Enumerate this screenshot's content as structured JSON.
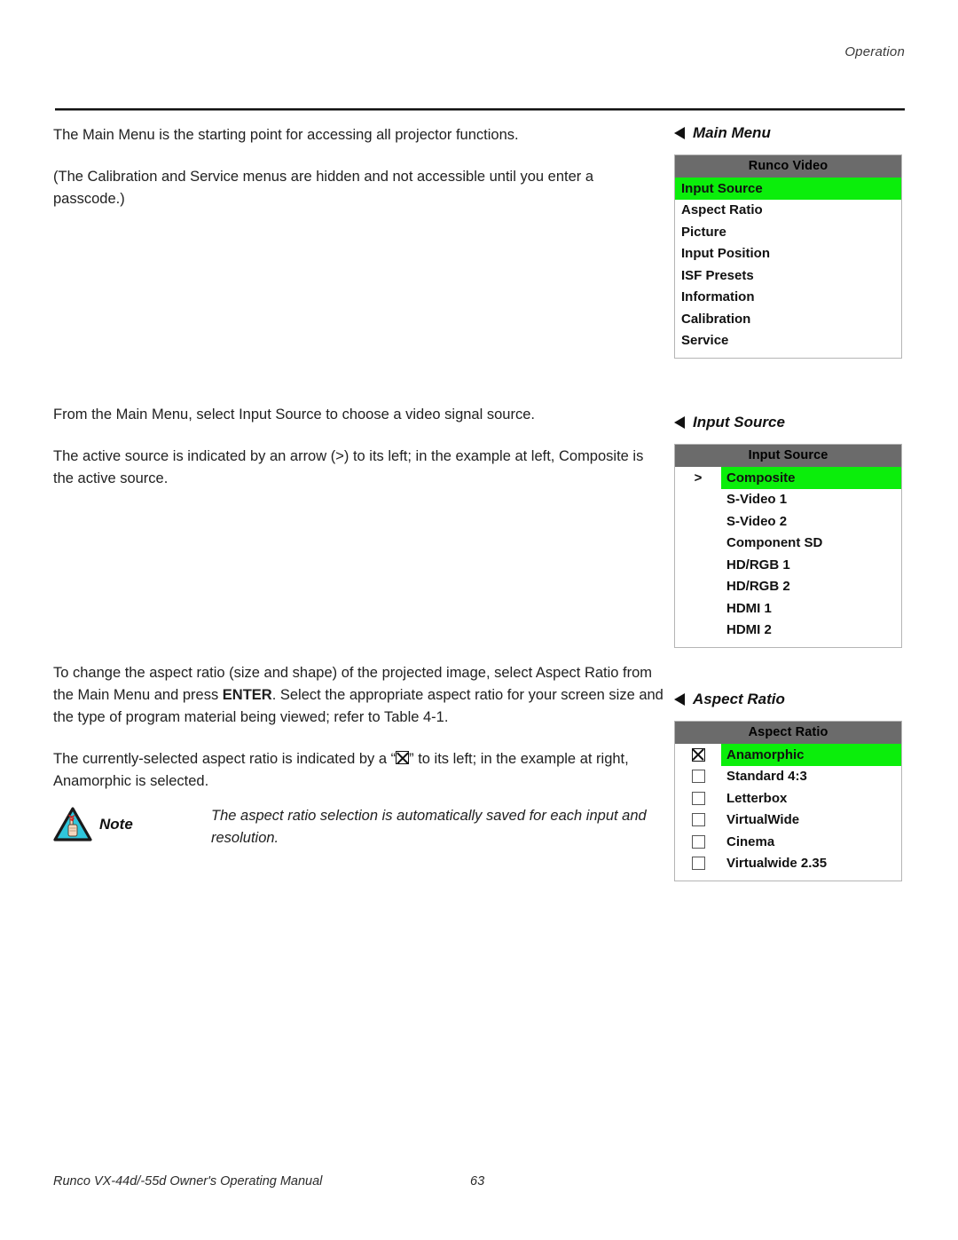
{
  "header": {
    "section_label": "Operation"
  },
  "footer": {
    "manual_title": "Runco VX-44d/-55d Owner's Operating Manual",
    "page_number": "63"
  },
  "colors": {
    "menu_header_bg": "#6B6B6B",
    "menu_highlight": "#0BEE0B",
    "note_icon": "#2FC6DC",
    "text": "#212121"
  },
  "sections": [
    {
      "id": "main-menu",
      "heading": "Main Menu",
      "paragraphs": [
        "The Main Menu is the starting point for accessing all projector functions.",
        "(The Calibration and Service menus are hidden and not accessible until you enter a passcode.)"
      ],
      "osd": {
        "title": "Runco Video",
        "marker_type": "none",
        "items": [
          {
            "label": "Input Source",
            "selected": true,
            "marker": ""
          },
          {
            "label": "Aspect Ratio",
            "selected": false,
            "marker": ""
          },
          {
            "label": "Picture",
            "selected": false,
            "marker": ""
          },
          {
            "label": "Input Position",
            "selected": false,
            "marker": ""
          },
          {
            "label": "ISF Presets",
            "selected": false,
            "marker": ""
          },
          {
            "label": "Information",
            "selected": false,
            "marker": ""
          },
          {
            "label": "Calibration",
            "selected": false,
            "marker": ""
          },
          {
            "label": "Service",
            "selected": false,
            "marker": ""
          }
        ]
      }
    },
    {
      "id": "input-source",
      "heading": "Input Source",
      "paragraphs": [
        "From the Main Menu, select Input Source to choose a video signal source.",
        "The active source is indicated by an arrow (>) to its left; in the example at left, Composite is the active source."
      ],
      "osd": {
        "title": "Input Source",
        "marker_type": "arrow",
        "items": [
          {
            "label": "Composite",
            "selected": true,
            "marker": ">"
          },
          {
            "label": "S-Video 1",
            "selected": false,
            "marker": ""
          },
          {
            "label": "S-Video 2",
            "selected": false,
            "marker": ""
          },
          {
            "label": "Component SD",
            "selected": false,
            "marker": ""
          },
          {
            "label": "HD/RGB 1",
            "selected": false,
            "marker": ""
          },
          {
            "label": "HD/RGB 2",
            "selected": false,
            "marker": ""
          },
          {
            "label": "HDMI 1",
            "selected": false,
            "marker": ""
          },
          {
            "label": "HDMI 2",
            "selected": false,
            "marker": ""
          }
        ]
      }
    },
    {
      "id": "aspect-ratio",
      "heading": "Aspect Ratio",
      "paragraphs": [
        "To change the aspect ratio (size and shape) of the projected image, select Aspect Ratio from the Main Menu and press ENTER. Select the appropriate aspect ratio for your screen size and the type of program material being viewed; refer to Table 4-1.",
        "The currently-selected aspect ratio is indicated by a “☒” to its left; in the example at right, Anamorphic is selected."
      ],
      "osd": {
        "title": "Aspect Ratio",
        "marker_type": "checkbox",
        "items": [
          {
            "label": "Anamorphic",
            "selected": true,
            "checked": true
          },
          {
            "label": "Standard 4:3",
            "selected": false,
            "checked": false
          },
          {
            "label": "Letterbox",
            "selected": false,
            "checked": false
          },
          {
            "label": "VirtualWide",
            "selected": false,
            "checked": false
          },
          {
            "label": "Cinema",
            "selected": false,
            "checked": false
          },
          {
            "label": "Virtualwide 2.35",
            "selected": false,
            "checked": false
          }
        ]
      }
    }
  ],
  "aspect_paragraph_parts": {
    "p1_a": "To change the aspect ratio (size and shape) of the projected image, select Aspect Ratio from the Main Menu and press ",
    "p1_bold": "ENTER",
    "p1_b": ". Select the appropriate aspect ratio for your screen size and the type of program material being viewed; refer to Table 4-1.",
    "p2_a": "The currently-selected aspect ratio is indicated by a “",
    "p2_b": "” to its left; in the example at right, Anamorphic is selected."
  },
  "note": {
    "label": "Note",
    "icon": "note-hand-triangle-icon",
    "text": "The aspect ratio selection is automatically saved for each input and resolution."
  }
}
